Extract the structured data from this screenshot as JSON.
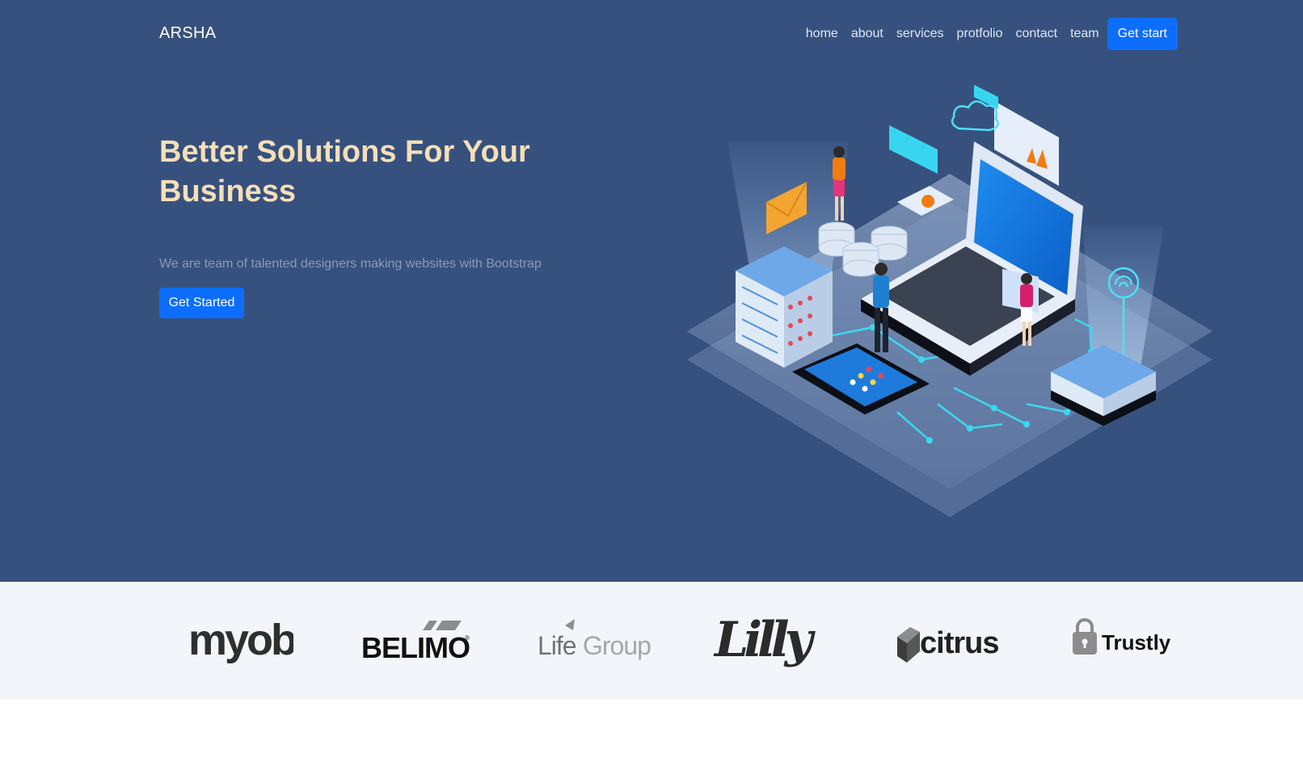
{
  "brand": "ARSHA",
  "nav": {
    "items": [
      "home",
      "about",
      "services",
      "protfolio",
      "contact",
      "team"
    ],
    "cta": "Get start"
  },
  "hero": {
    "title": "Better Solutions For Your Business",
    "subtitle": "We are team of talented designers making websites with Bootstrap",
    "button": "Get Started"
  },
  "clients": [
    "myob",
    "BELIMO",
    "LifeGroups",
    "Lilly",
    "citrus",
    "Trustly"
  ],
  "colors": {
    "hero_bg": "#37517e",
    "title": "#f6dfb7",
    "accent": "#0d6efd",
    "clients_bg": "#f3f5fa"
  }
}
